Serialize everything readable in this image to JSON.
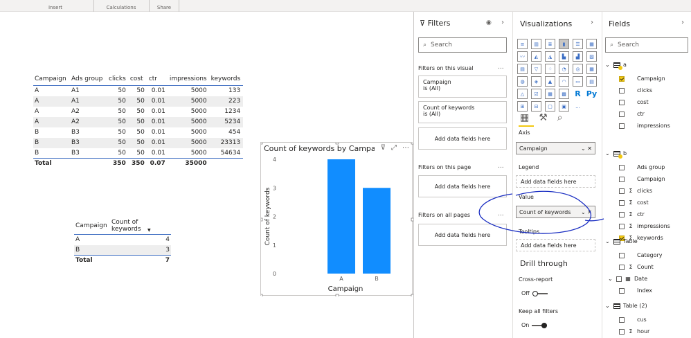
{
  "ribbon": {
    "groups": [
      "Insert",
      "Calculations",
      "Share"
    ]
  },
  "table1": {
    "headers": [
      "Campaign",
      "Ads group",
      "clicks",
      "cost",
      "ctr",
      "impressions",
      "keywords"
    ],
    "rows": [
      [
        "A",
        "A1",
        "50",
        "50",
        "0.01",
        "5000",
        "133"
      ],
      [
        "A",
        "A1",
        "50",
        "50",
        "0.01",
        "5000",
        "223"
      ],
      [
        "A",
        "A2",
        "50",
        "50",
        "0.01",
        "5000",
        "1234"
      ],
      [
        "A",
        "A2",
        "50",
        "50",
        "0.01",
        "5000",
        "5234"
      ],
      [
        "B",
        "B3",
        "50",
        "50",
        "0.01",
        "5000",
        "454"
      ],
      [
        "B",
        "B3",
        "50",
        "50",
        "0.01",
        "5000",
        "23313"
      ],
      [
        "B",
        "B3",
        "50",
        "50",
        "0.01",
        "5000",
        "54634"
      ]
    ],
    "total": [
      "Total",
      "",
      "350",
      "350",
      "0.07",
      "35000",
      ""
    ]
  },
  "table2": {
    "headers": [
      "Campaign",
      "Count of keywords"
    ],
    "rows": [
      [
        "A",
        "4"
      ],
      [
        "B",
        "3"
      ]
    ],
    "total": [
      "Total",
      "7"
    ]
  },
  "chart_data": {
    "type": "bar",
    "title": "Count of keywords by Campa",
    "categories": [
      "A",
      "B"
    ],
    "values": [
      4,
      3
    ],
    "xlabel": "Campaign",
    "ylabel": "Count of keywords",
    "ylim": [
      0,
      4
    ],
    "yticks": [
      "0",
      "1",
      "2",
      "3",
      "4"
    ],
    "color": "#118dff",
    "grid": false
  },
  "filters": {
    "title": "Filters",
    "search_placeholder": "Search",
    "on_visual_label": "Filters on this visual",
    "card1_line1": "Campaign",
    "card1_line2": "is (All)",
    "card2_line1": "Count of keywords",
    "card2_line2": "is (All)",
    "add_here": "Add data fields here",
    "on_page_label": "Filters on this page",
    "on_all_label": "Filters on all pages",
    "dots": "..."
  },
  "viz": {
    "title": "Visualizations",
    "icon_r": "R",
    "icon_py": "Py",
    "more": "...",
    "axis_label": "Axis",
    "axis_value": "Campaign",
    "legend_label": "Legend",
    "add_here": "Add data fields here",
    "value_label": "Value",
    "value_value": "Count of keywords",
    "tooltips_label": "Tooltips",
    "drill_title": "Drill through",
    "cross_report": "Cross-report",
    "off": "Off",
    "keep_filters": "Keep all filters",
    "on": "On"
  },
  "fields": {
    "title": "Fields",
    "search_placeholder": "Search",
    "table_a": "a",
    "a_fields": [
      {
        "name": "Campaign",
        "checked": true,
        "sigma": false
      },
      {
        "name": "clicks",
        "checked": false,
        "sigma": false
      },
      {
        "name": "cost",
        "checked": false,
        "sigma": false
      },
      {
        "name": "ctr",
        "checked": false,
        "sigma": false
      },
      {
        "name": "impressions",
        "checked": false,
        "sigma": false
      }
    ],
    "table_b": "b",
    "b_fields": [
      {
        "name": "Ads group",
        "checked": false,
        "sigma": false
      },
      {
        "name": "Campaign",
        "checked": false,
        "sigma": false
      },
      {
        "name": "clicks",
        "checked": false,
        "sigma": true
      },
      {
        "name": "cost",
        "checked": false,
        "sigma": true
      },
      {
        "name": "ctr",
        "checked": false,
        "sigma": true
      },
      {
        "name": "impressions",
        "checked": false,
        "sigma": true
      },
      {
        "name": "keywords",
        "checked": true,
        "sigma": true
      }
    ],
    "table_t": "Table",
    "t_fields": [
      {
        "name": "Category",
        "checked": false,
        "sigma": false
      },
      {
        "name": "Count",
        "checked": false,
        "sigma": true
      },
      {
        "name": "Date",
        "checked": false,
        "sigma": false,
        "date": true
      },
      {
        "name": "Index",
        "checked": false,
        "sigma": false
      }
    ],
    "table_t2": "Table (2)",
    "t2_fields": [
      {
        "name": "cus",
        "checked": false,
        "sigma": false
      },
      {
        "name": "hour",
        "checked": false,
        "sigma": true
      }
    ]
  }
}
